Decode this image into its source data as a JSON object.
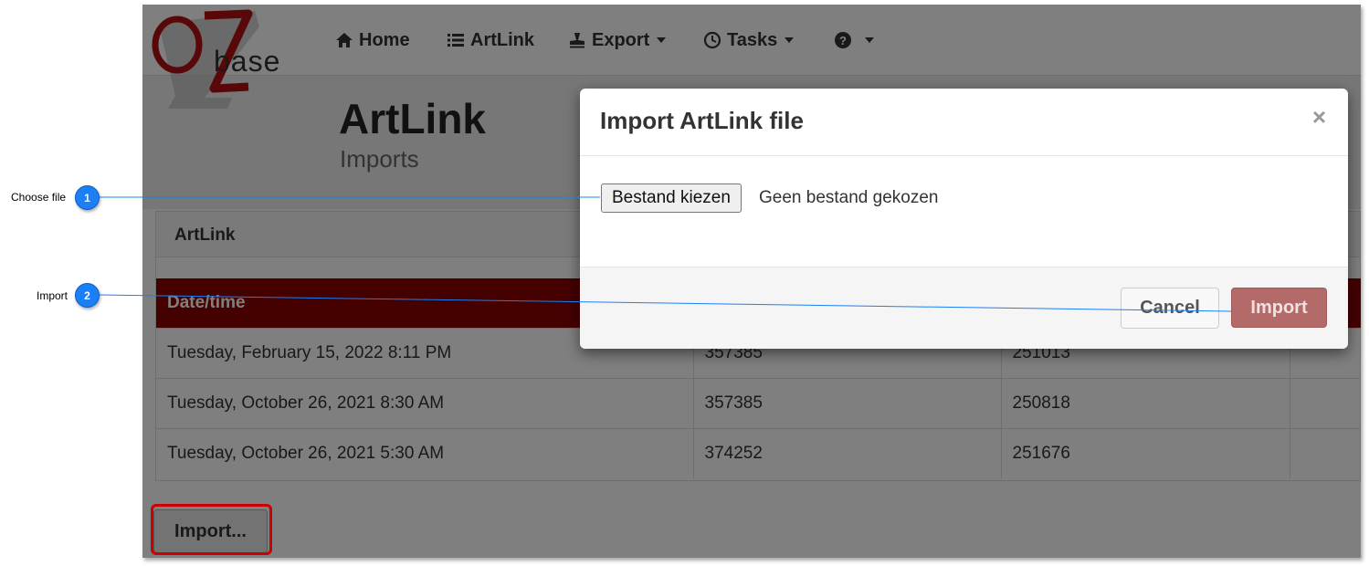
{
  "navbar": {
    "logo_text": "base",
    "items": [
      {
        "label": "Home",
        "icon": "home-icon"
      },
      {
        "label": "ArtLink",
        "icon": "list-icon"
      },
      {
        "label": "Export",
        "icon": "stamp-icon"
      },
      {
        "label": "Tasks",
        "icon": "clock-icon"
      }
    ]
  },
  "header": {
    "title": "ArtLink",
    "subtitle": "Imports"
  },
  "panel": {
    "title": "ArtLink",
    "columns": [
      "Date/time",
      "",
      "",
      ""
    ],
    "rows": [
      [
        "Tuesday, February 15, 2022 8:11 PM",
        "357385",
        "251013",
        ""
      ],
      [
        "Tuesday, October 26, 2021 8:30 AM",
        "357385",
        "250818",
        ""
      ],
      [
        "Tuesday, October 26, 2021 5:30 AM",
        "374252",
        "251676",
        ""
      ]
    ]
  },
  "import_button_label": "Import...",
  "modal": {
    "title": "Import ArtLink file",
    "close": "×",
    "file_button": "Bestand kiezen",
    "file_status": "Geen bestand gekozen",
    "cancel": "Cancel",
    "import": "Import"
  },
  "callouts": [
    {
      "number": "1",
      "label": "Choose file"
    },
    {
      "number": "2",
      "label": "Import"
    }
  ],
  "colors": {
    "table_header": "#8b0000",
    "callout": "#1c7ff5",
    "highlight": "#cc0000",
    "primary_disabled": "#b56a6a"
  }
}
